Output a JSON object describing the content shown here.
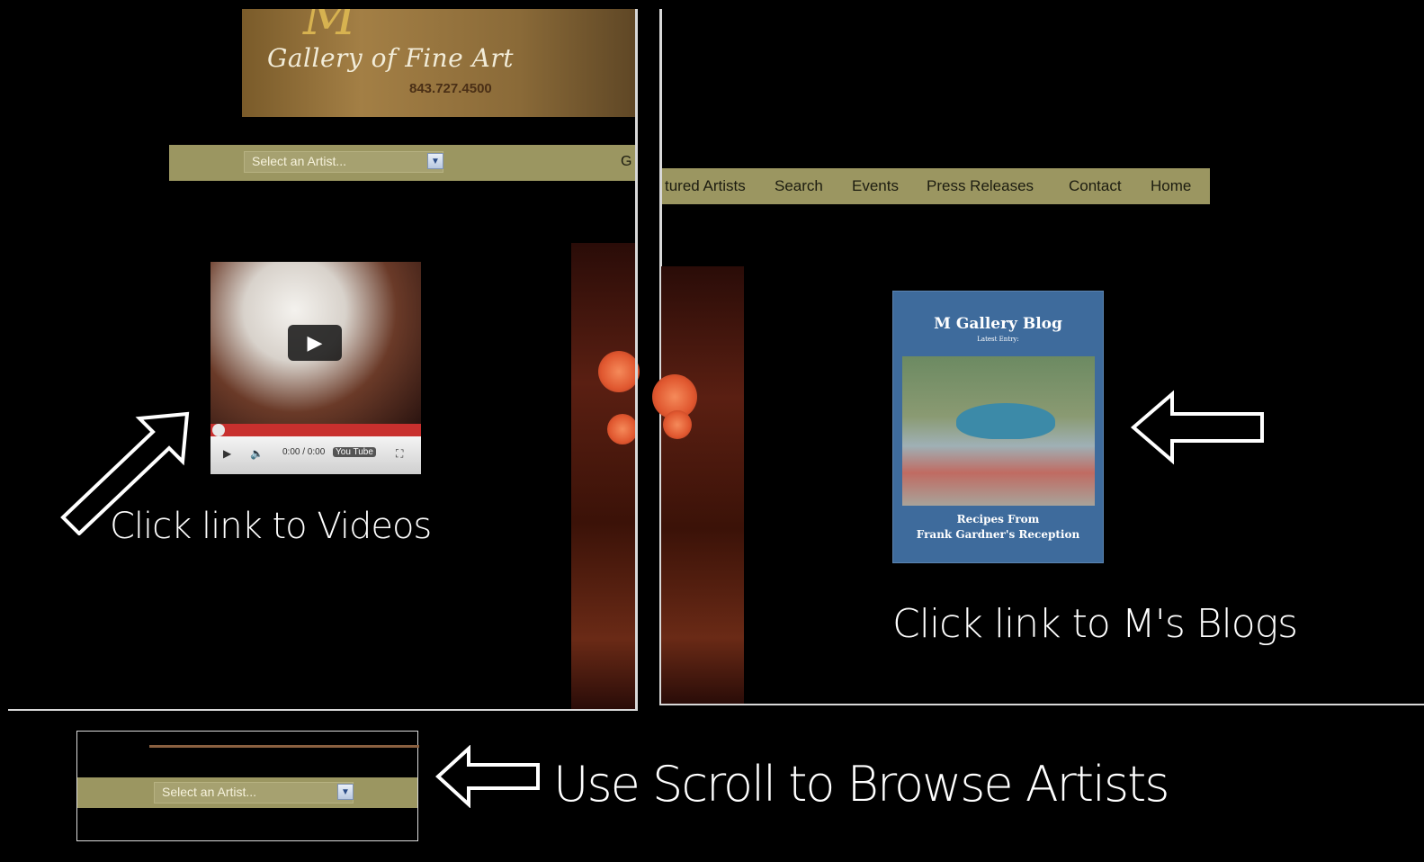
{
  "gallery": {
    "logo_letter": "M",
    "name": "Gallery of Fine Art",
    "phone": "843.727.4500"
  },
  "artist_select": {
    "value": "Select an Artist...",
    "value_small": "Select an Artist..."
  },
  "nav_left_fragment": "G",
  "nav": [
    "tured Artists",
    "Search",
    "Events",
    "Press Releases",
    "Contact",
    "Home"
  ],
  "video": {
    "time": "0:00 / 0:00",
    "brand": "You Tube"
  },
  "blog": {
    "title": "M Gallery Blog",
    "subtitle": "Latest Entry:",
    "caption_line1": "Recipes From",
    "caption_line2": "Frank Gardner's Reception"
  },
  "annotations": {
    "videos": "Click  link to Videos",
    "blogs": "Click  link to M's Blogs",
    "scroll": "Use Scroll to Browse Artists"
  },
  "colors": {
    "nav_bar": "#9b9661",
    "background": "#000000",
    "blog_cover": "#3e6b9c"
  },
  "icons": [
    "chevron-down-icon",
    "play-icon",
    "volume-icon",
    "fullscreen-icon",
    "arrow-up-right-icon",
    "arrow-left-icon"
  ]
}
